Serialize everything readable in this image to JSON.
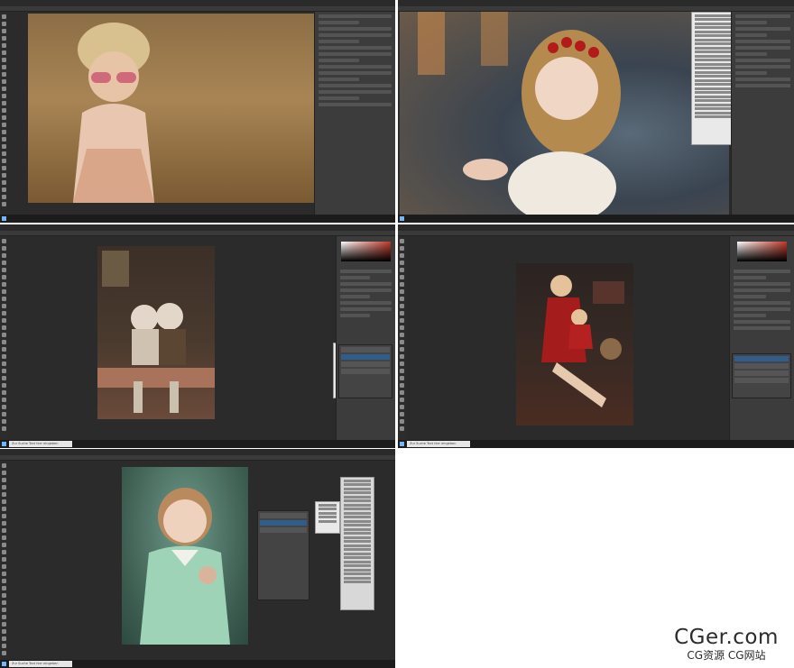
{
  "screens": [
    {
      "id": "s1",
      "photo": "girl-in-wheat-field-photo"
    },
    {
      "id": "s2",
      "photo": "winter-girl-blowing-snow-photo"
    },
    {
      "id": "s3",
      "photo": "two-children-on-bench-photo"
    },
    {
      "id": "s4",
      "photo": "mother-daughter-reading-photo"
    },
    {
      "id": "s5",
      "photo": "girl-with-doll-photo"
    }
  ],
  "taskbar": {
    "search_placeholder": "Zur Suche Text hier eingeben"
  },
  "watermark": {
    "main": "CGer.com",
    "sub": "CG资源 CG网站"
  },
  "colors": {
    "ps_bg": "#323232",
    "canvas": "#2b2b2b",
    "panel": "#3c3c3c",
    "taskbar": "#1c1c1c",
    "selection": "#2f5e8c"
  }
}
